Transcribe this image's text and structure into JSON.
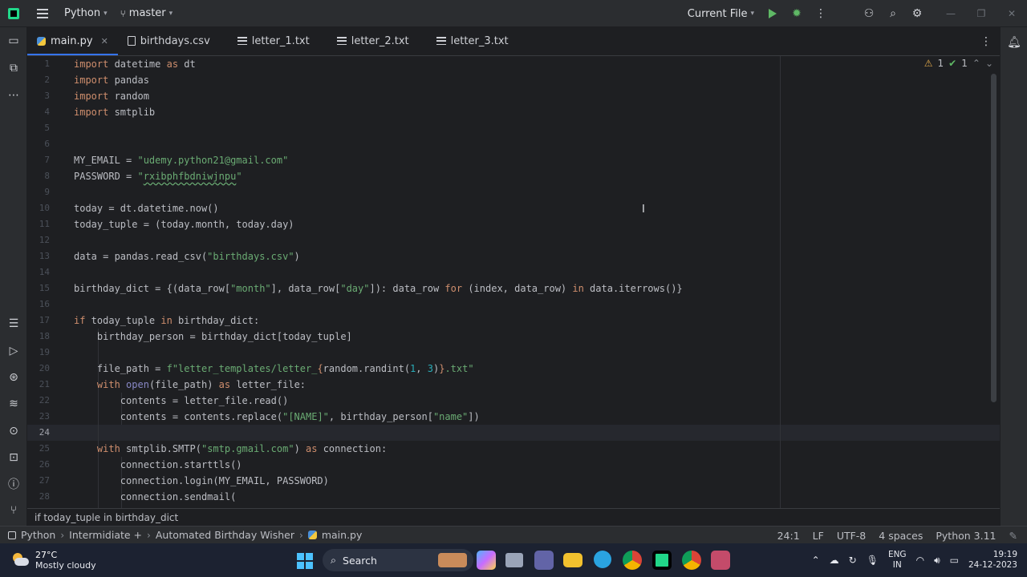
{
  "titlebar": {
    "project": "Python",
    "branch": "master",
    "run_config": "Current File"
  },
  "tabs": [
    {
      "label": "main.py",
      "type": "py",
      "active": true
    },
    {
      "label": "birthdays.csv",
      "type": "csv",
      "active": false
    },
    {
      "label": "letter_1.txt",
      "type": "txt",
      "active": false
    },
    {
      "label": "letter_2.txt",
      "type": "txt",
      "active": false
    },
    {
      "label": "letter_3.txt",
      "type": "txt",
      "active": false
    }
  ],
  "inspections": {
    "warnings": "1",
    "ok": "1"
  },
  "editor": {
    "current_line": 24,
    "line_numbers": [
      "1",
      "2",
      "3",
      "4",
      "5",
      "6",
      "7",
      "8",
      "9",
      "10",
      "11",
      "12",
      "13",
      "14",
      "15",
      "16",
      "17",
      "18",
      "19",
      "20",
      "21",
      "22",
      "23",
      "24",
      "25",
      "26",
      "27",
      "28"
    ]
  },
  "hint": "if today_tuple in birthday_dict",
  "breadcrumb": [
    "Python",
    "Intermidiate +",
    "Automated Birthday Wisher",
    "main.py"
  ],
  "status": {
    "position": "24:1",
    "line_sep": "LF",
    "encoding": "UTF-8",
    "indent": "4 spaces",
    "interpreter": "Python 3.11"
  },
  "taskbar": {
    "temperature": "27°C",
    "weather": "Mostly cloudy",
    "search": "Search",
    "lang1": "ENG",
    "lang2": "IN",
    "time": "19:19",
    "date": "24-12-2023"
  },
  "colors": {
    "keyword": "#cf8e6d",
    "string": "#6aab73",
    "number": "#2aacb8",
    "accent": "#3574f0",
    "run": "#5fb865"
  }
}
